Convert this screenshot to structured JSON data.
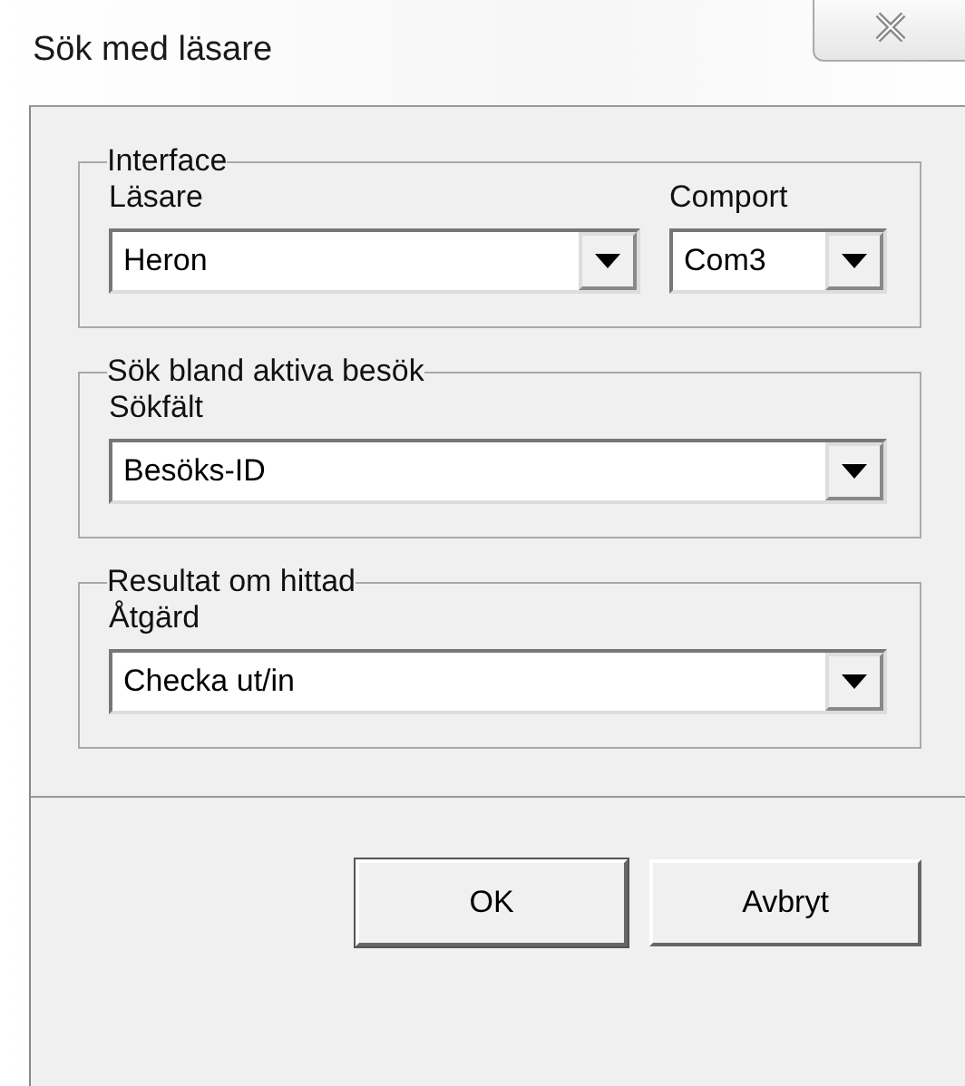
{
  "window": {
    "title": "Sök med läsare"
  },
  "groups": [
    {
      "title": "Interface",
      "fields": [
        {
          "label": "Läsare",
          "value": "Heron",
          "kind": "wide"
        },
        {
          "label": "Comport",
          "value": "Com3",
          "kind": "narrow"
        }
      ]
    },
    {
      "title": "Sök bland aktiva besök",
      "fields": [
        {
          "label": "Sökfält",
          "value": "Besöks-ID",
          "kind": "wide"
        }
      ]
    },
    {
      "title": "Resultat om hittad",
      "fields": [
        {
          "label": "Åtgärd",
          "value": "Checka ut/in",
          "kind": "wide"
        }
      ]
    }
  ],
  "buttons": [
    {
      "label": "OK",
      "default": true
    },
    {
      "label": "Avbryt",
      "default": false
    }
  ]
}
